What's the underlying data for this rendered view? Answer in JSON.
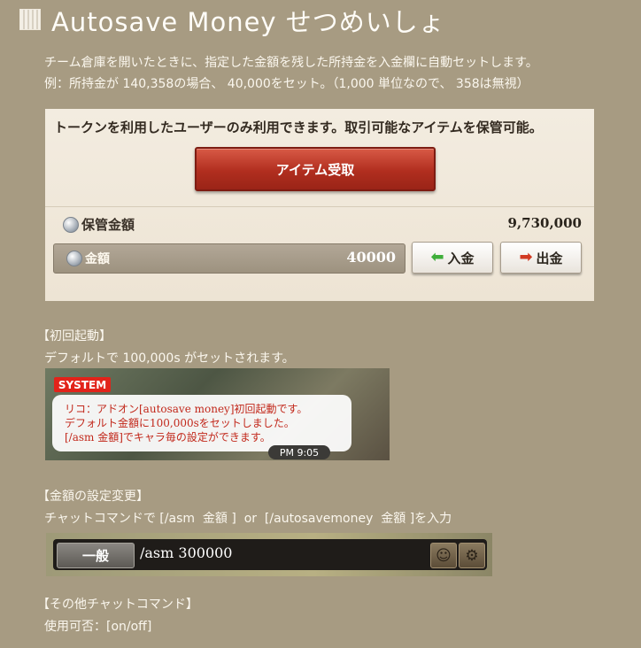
{
  "title": "Autosave Money せつめいしょ",
  "intro": {
    "line1": "チーム倉庫を開いたときに、指定した金額を残した所持金を入金欄に自動セットします。",
    "line2": "例：所持金が 140,358の場合、 40,000をセット。（1,000 単位なので、 358は無視）"
  },
  "storage_panel": {
    "notice": "トークンを利用したユーザーのみ利用できます。取引可能なアイテムを保管可能。",
    "receive_button": "アイテム受取",
    "stored_label": "保管金額",
    "stored_value": "9,730,000",
    "amount_label": "金額",
    "amount_value": "40000",
    "deposit_button": "入金",
    "withdraw_button": "出金"
  },
  "first_launch": {
    "heading": "【初回起動】",
    "desc": "デフォルトで 100,000s がセットされます。"
  },
  "system_chat": {
    "tag": "SYSTEM",
    "line1": "リコ：アドオン[autosave money]初回起動です。",
    "line2": "デフォルト金額に100,000sをセットしました。",
    "line3": "[/asm 金額]でキャラ毎の設定ができます。",
    "time": "PM 9:05"
  },
  "amount_change": {
    "heading": "【金額の設定変更】",
    "desc": "チャットコマンドで [/asm  金額 ]  or  [/autosavemoney  金額 ]を入力"
  },
  "chat_input": {
    "channel": "一般",
    "command": "/asm 300000"
  },
  "other_commands": {
    "heading": "【その他チャットコマンド】",
    "line1": "使用可否：[on/off]"
  },
  "icons": {
    "title": "notepad-icon",
    "coin": "silver-coin-icon",
    "deposit": "green-left-arrow-icon",
    "withdraw": "red-right-arrow-icon",
    "emote": "smiley-icon",
    "settings": "gear-icon"
  }
}
